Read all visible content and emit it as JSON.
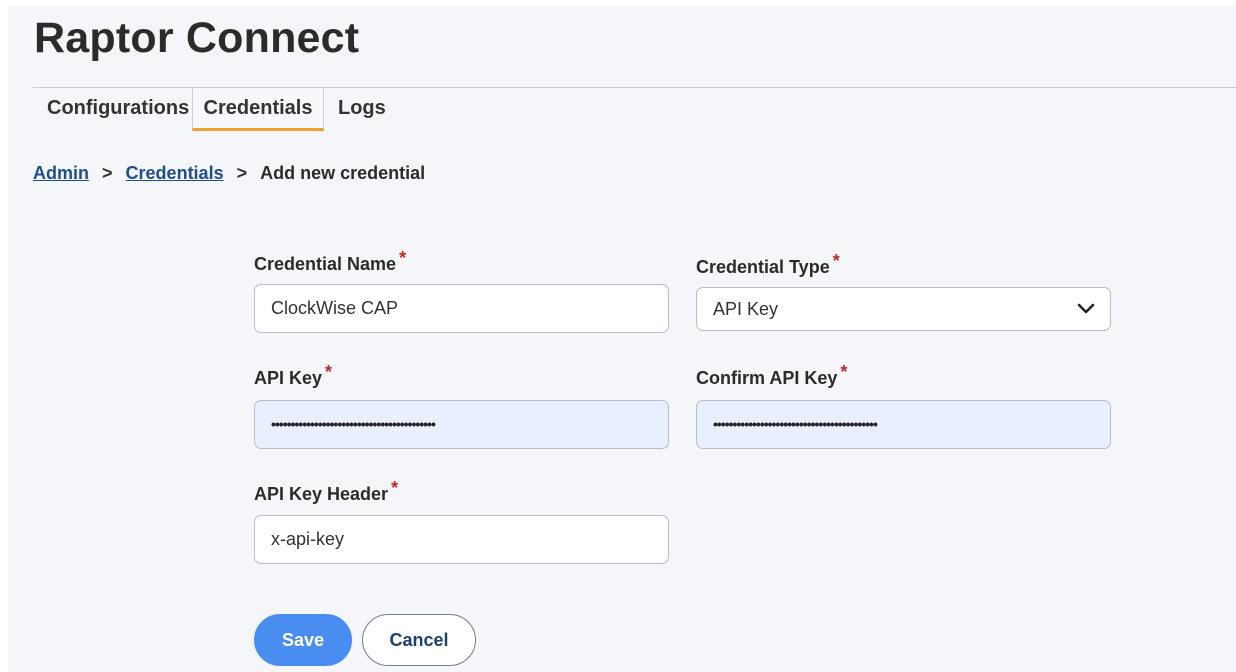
{
  "app": {
    "title": "Raptor Connect"
  },
  "tabs": [
    {
      "label": "Configurations",
      "active": false
    },
    {
      "label": "Credentials",
      "active": true
    },
    {
      "label": "Logs",
      "active": false
    }
  ],
  "breadcrumb": {
    "items": [
      "Admin",
      "Credentials"
    ],
    "current": "Add new credential",
    "separator": ">"
  },
  "form": {
    "credential_name": {
      "label": "Credential Name",
      "required_mark": "*",
      "value": "ClockWise CAP"
    },
    "credential_type": {
      "label": "Credential Type",
      "required_mark": "*",
      "value": "API Key"
    },
    "api_key": {
      "label": "API Key",
      "required_mark": "*",
      "value": "••••••••••••••••••••••••••••••••••••••••••"
    },
    "confirm_api_key": {
      "label": "Confirm API Key",
      "required_mark": "*",
      "value": "••••••••••••••••••••••••••••••••••••••••••"
    },
    "api_key_header": {
      "label": "API Key Header",
      "required_mark": "*",
      "value": "x-api-key"
    }
  },
  "buttons": {
    "save": "Save",
    "cancel": "Cancel"
  },
  "colors": {
    "primary": "#4a8df0",
    "active_tab_underline": "#f0a22e",
    "required": "#c0262d",
    "link": "#1f4e8c",
    "autofill_background": "#e8f0fe"
  }
}
